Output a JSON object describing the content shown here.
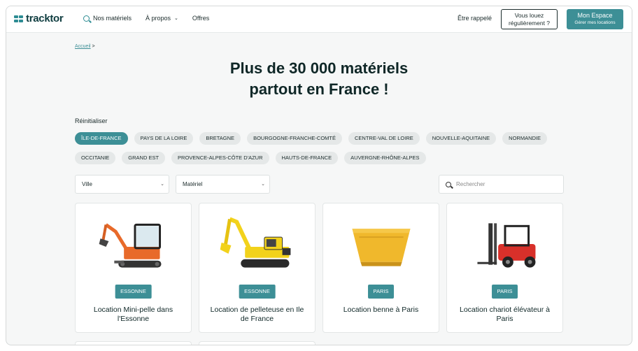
{
  "header": {
    "logo_text": "tracktor",
    "nav": [
      {
        "label": "Nos matériels",
        "icon": "search-icon"
      },
      {
        "label": "À propos",
        "icon": "chevron-down-icon"
      },
      {
        "label": "Offres"
      }
    ],
    "callback_label": "Être rappelé",
    "outline_button": {
      "line1": "Vous louez",
      "line2": "régulièrement ?"
    },
    "primary_button": {
      "line1": "Mon Espace",
      "line2": "Gérer mes locations"
    }
  },
  "breadcrumb": {
    "home": "Accueil",
    "separator": ">"
  },
  "title": {
    "line1": "Plus de 30 000 matériels",
    "line2": "partout en France !"
  },
  "filters": {
    "reset_label": "Réinitialiser",
    "regions_row1": [
      "ÎLE-DE-FRANCE",
      "PAYS DE LA LOIRE",
      "BRETAGNE",
      "BOURGOGNE-FRANCHE-COMTÉ",
      "CENTRE-VAL DE LOIRE",
      "NOUVELLE-AQUITAINE",
      "NORMANDIE"
    ],
    "regions_row2": [
      "OCCITANIE",
      "GRAND EST",
      "PROVENCE-ALPES-CÔTE D'AZUR",
      "HAUTS-DE-FRANCE",
      "AUVERGNE-RHÔNE-ALPES"
    ],
    "active_region": "ÎLE-DE-FRANCE",
    "city_select": "Ville",
    "material_select": "Matériel",
    "search_placeholder": "Rechercher"
  },
  "cards": [
    {
      "badge": "ESSONNE",
      "title": "Location Mini-pelle dans l'Essonne",
      "image": "mini-excavator"
    },
    {
      "badge": "ESSONNE",
      "title": "Location de pelleteuse en Ile de France",
      "image": "excavator"
    },
    {
      "badge": "PARIS",
      "title": "Location benne à Paris",
      "image": "dumpster"
    },
    {
      "badge": "PARIS",
      "title": "Location chariot élévateur à Paris",
      "image": "forklift"
    }
  ],
  "colors": {
    "accent": "#3d8f96",
    "brand_dark": "#0f3d40",
    "chip_bg": "#e5e8e8"
  }
}
